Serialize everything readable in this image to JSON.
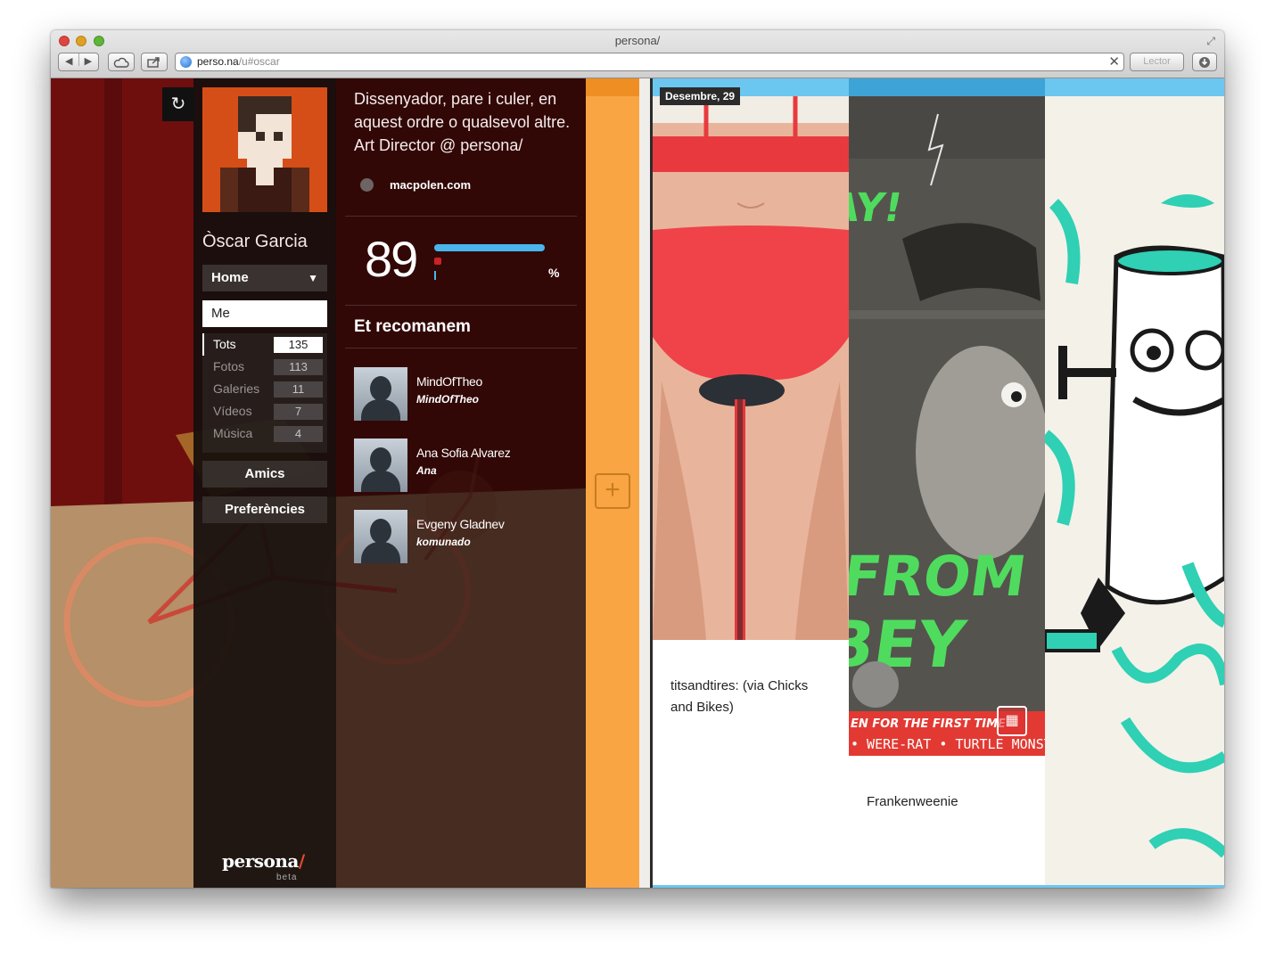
{
  "browser": {
    "window_title": "persona/",
    "url_host": "perso.na",
    "url_path": "/u#oscar",
    "reader_label": "Lector",
    "back_glyph": "◀",
    "forward_glyph": "▶",
    "icons": [
      "back-icon",
      "forward-icon",
      "icloud-icon",
      "share-icon",
      "globe-icon",
      "clear-icon",
      "download-icon",
      "fullscreen-icon"
    ]
  },
  "profile": {
    "name": "Òscar Garcia",
    "bio": "Dissenyador, pare i culer, en aquest ordre o qualsevol altre. Art Director @ persona/",
    "website": "macpolen.com",
    "score": "89",
    "score_unit": "%",
    "score_fraction": 0.89
  },
  "sidebar": {
    "view_select": "Home",
    "me_field": "Me",
    "filters": [
      {
        "label": "Tots",
        "count": "135",
        "active": true
      },
      {
        "label": "Fotos",
        "count": "113",
        "active": false
      },
      {
        "label": "Galeries",
        "count": "11",
        "active": false
      },
      {
        "label": "Vídeos",
        "count": "7",
        "active": false
      },
      {
        "label": "Música",
        "count": "4",
        "active": false
      }
    ],
    "friends_label": "Amics",
    "prefs_label": "Preferències",
    "logo_text": "persona",
    "logo_slash": "/",
    "logo_beta": "beta"
  },
  "recommend": {
    "title": "Et recomanem",
    "users": [
      {
        "name": "MindOfTheo",
        "handle": "MindOfTheo"
      },
      {
        "name": "Ana Sofia Alvarez",
        "handle": "Ana"
      },
      {
        "name": "Evgeny Gladnev",
        "handle": "komunado"
      }
    ]
  },
  "feed": {
    "add_glyph": "+",
    "date": "Desembre, 29",
    "posts": [
      {
        "caption_line1": "titsandtires: (via Chicks",
        "caption_line2": "and Bikes)"
      },
      {
        "caption_line1": "Frankenweenie"
      }
    ],
    "poster_text": {
      "headline_a": "K FROM",
      "headline_b": "BEY",
      "yay": "AY!",
      "band_1": "EN FOR THE FIRST TIME",
      "band_2": "• WERE-RAT • TURTLE MONSTER"
    },
    "colors": {
      "accent_blue": "#6cc7f0",
      "orange": "#f9a544",
      "poster_green": "#4fdc5e",
      "teal": "#2fd0b4"
    }
  }
}
